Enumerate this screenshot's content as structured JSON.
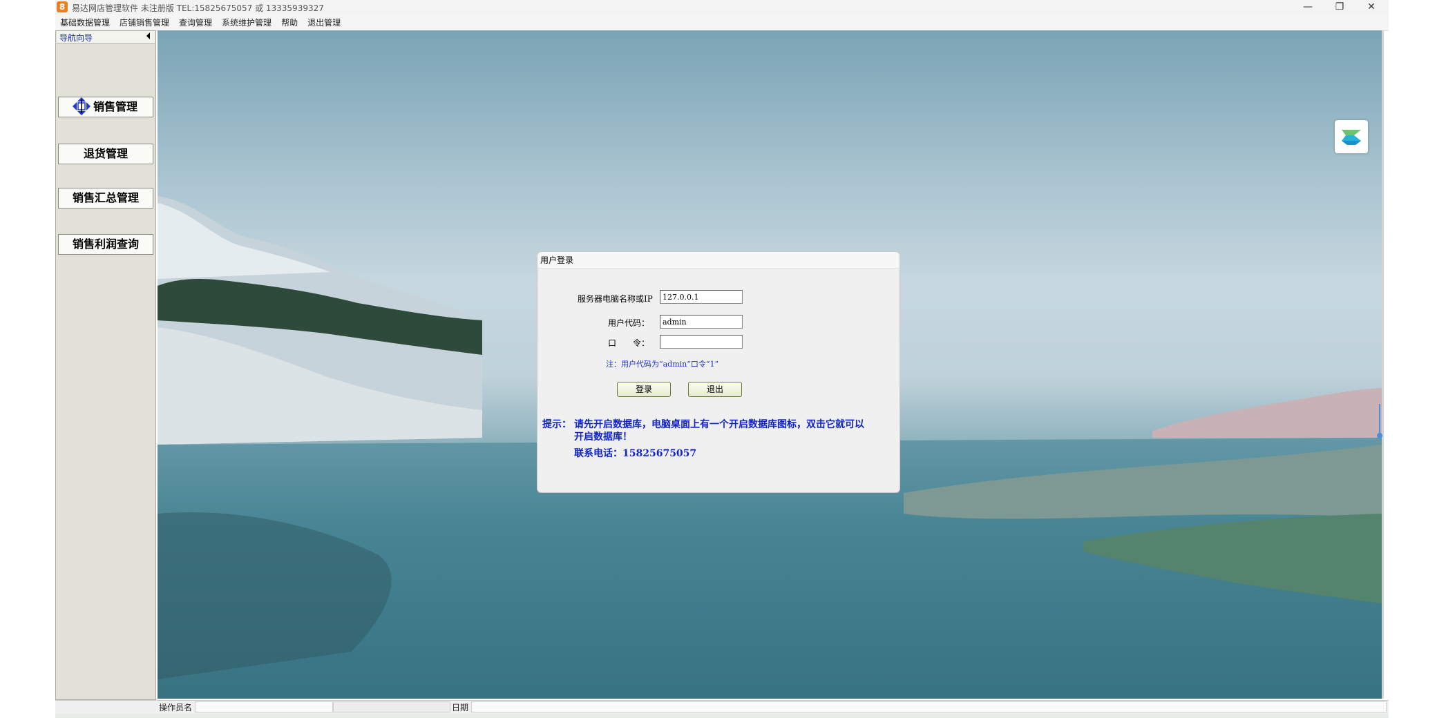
{
  "window": {
    "app_icon_glyph": "8",
    "title": "易达网店管理软件   未注册版 TEL:15825675057 或 13335939327",
    "minimize_glyph": "—",
    "restore_glyph": "❐",
    "close_glyph": "✕"
  },
  "menu": {
    "items": [
      "基础数据管理",
      "店铺销售管理",
      "查询管理",
      "系统维护管理",
      "帮助",
      "退出管理"
    ]
  },
  "sidebar": {
    "header": "导航向导",
    "items": [
      {
        "label": "销售管理",
        "icon": "nav-arrow-icon"
      },
      {
        "label": "退货管理"
      },
      {
        "label": "销售汇总管理"
      },
      {
        "label": "销售利润查询"
      }
    ]
  },
  "status": {
    "operator_label": "操作员名",
    "date_label": "日期"
  },
  "login": {
    "title": "用户登录",
    "server_label": "服务器电脑名称或IP",
    "server_value": "127.0.0.1",
    "user_label": "用户代码：",
    "user_value": "admin",
    "password_label": "口　　令：",
    "password_value": "",
    "note": "注：用户代码为“admin”口令“1”",
    "login_button": "登录",
    "exit_button": "退出",
    "hint_prefix": "提示：",
    "hint_line1": "请先开启数据库，电脑桌面上有一个开启数据库图标，双击它就可以",
    "hint_line2": "开启数据库！",
    "contact": "联系电话：15825675057"
  },
  "colors": {
    "accent_blue": "#1024c8",
    "app_icon": "#f07e1a"
  }
}
